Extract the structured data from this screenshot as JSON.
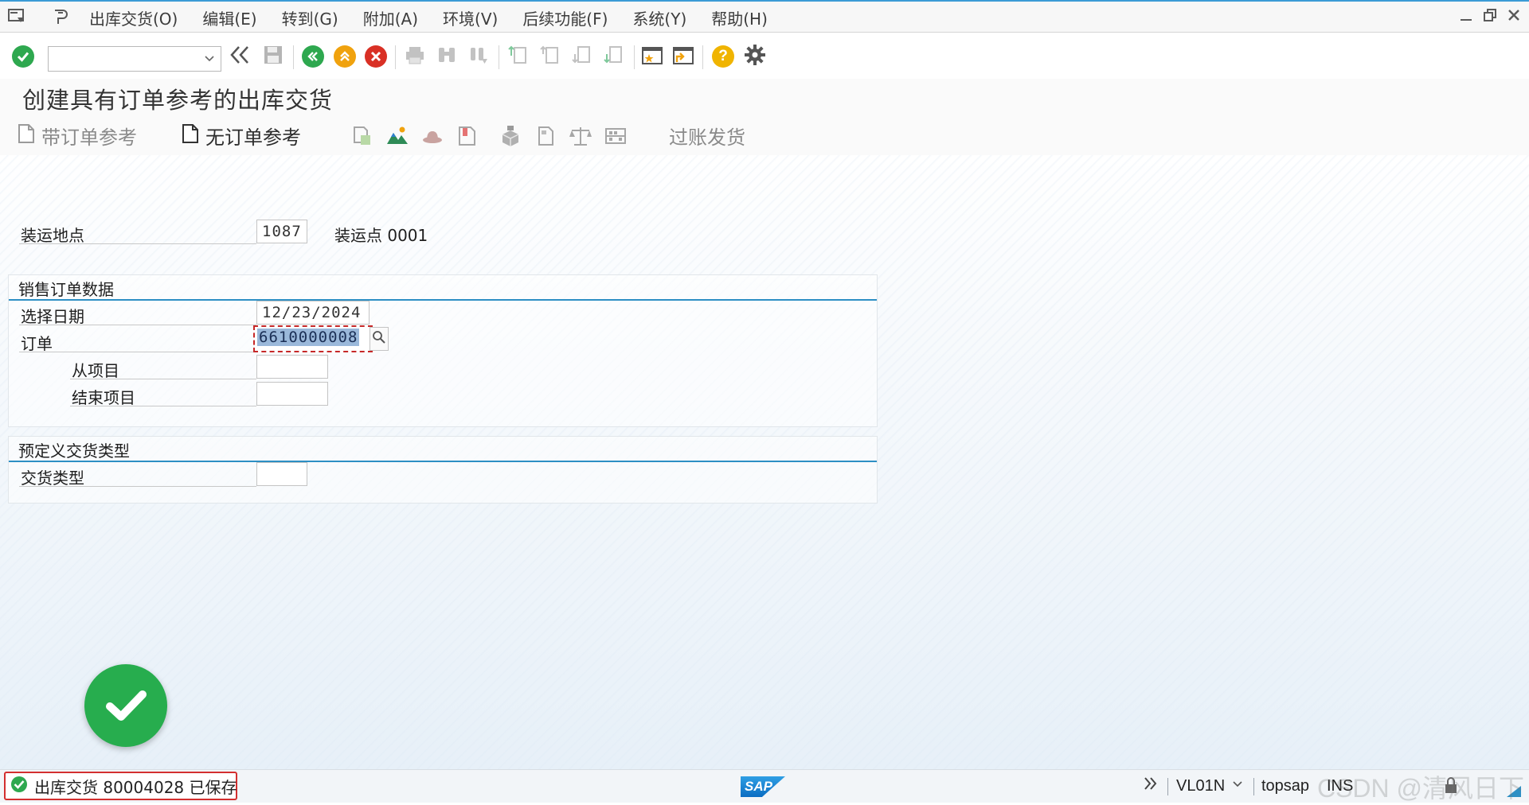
{
  "menubar": {
    "items": [
      "出库交货(O)",
      "编辑(E)",
      "转到(G)",
      "附加(A)",
      "环境(V)",
      "后续功能(F)",
      "系统(Y)",
      "帮助(H)"
    ]
  },
  "toolbar": {
    "command_value": ""
  },
  "page": {
    "title": "创建具有订单参考的出库交货"
  },
  "app_toolbar": {
    "with_order_ref": "带订单参考",
    "without_order_ref": "无订单参考",
    "post_goods_issue": "过账发货"
  },
  "form": {
    "shipping_point_label": "装运地点",
    "shipping_point_value": "1087",
    "shipping_point_desc": "装运点 0001",
    "sales_group_title": "销售订单数据",
    "selection_date_label": "选择日期",
    "selection_date_value": "12/23/2024",
    "order_label": "订单",
    "order_value": "6610000008",
    "from_item_label": "从项目",
    "from_item_value": "",
    "to_item_label": "结束项目",
    "to_item_value": "",
    "predef_group_title": "预定义交货类型",
    "delivery_type_label": "交货类型",
    "delivery_type_value": ""
  },
  "statusbar": {
    "message": "出库交货 80004028 已保存",
    "sap_logo": "SAP",
    "transaction": "VL01N",
    "user": "topsap",
    "mode": "INS",
    "watermark": "CSDN @清风日下"
  },
  "colors": {
    "accent": "#2d8fc4",
    "success": "#27ad4e",
    "error": "#d32f2f",
    "selection": "#9ab8da"
  }
}
